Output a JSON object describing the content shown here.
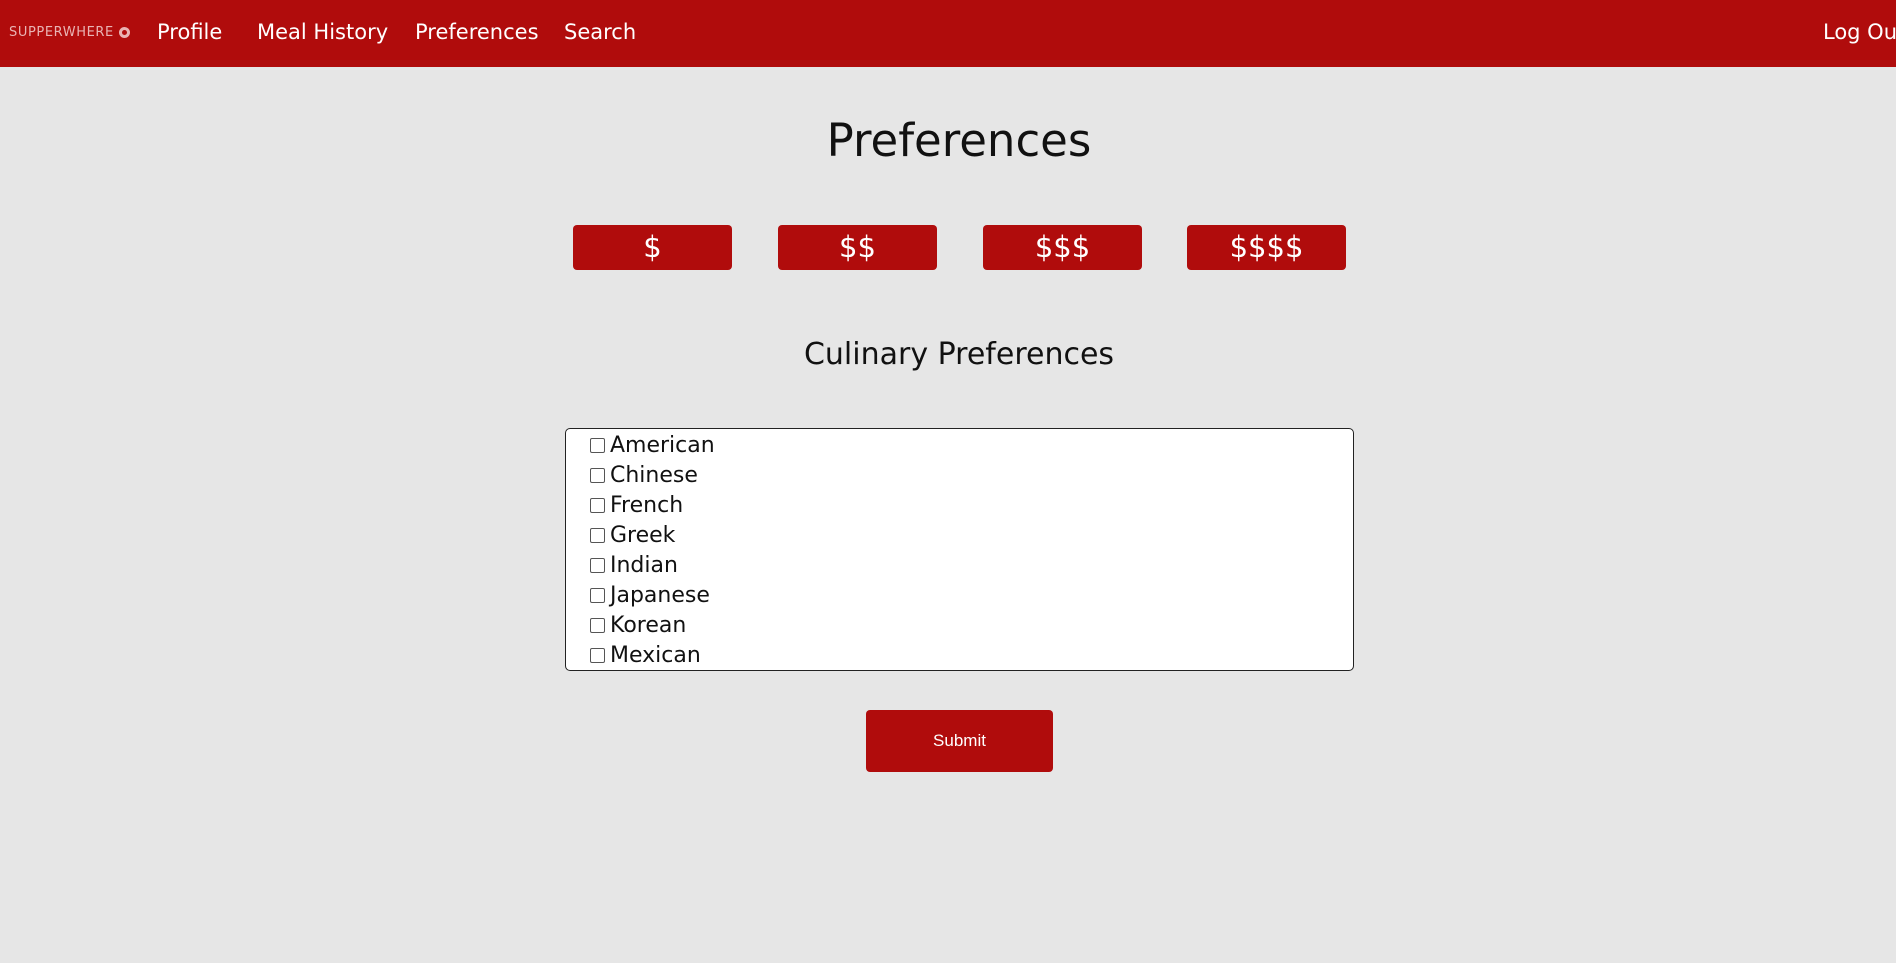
{
  "nav": {
    "brand": "SUPPERWHERE",
    "links": {
      "profile": "Profile",
      "meal_history": "Meal History",
      "preferences": "Preferences",
      "search": "Search",
      "logout": "Log Out"
    }
  },
  "main": {
    "title": "Preferences",
    "price_options": [
      "$",
      "$$",
      "$$$",
      "$$$$"
    ],
    "culinary_title": "Culinary Preferences",
    "cuisines": [
      {
        "label": "American",
        "checked": false
      },
      {
        "label": "Chinese",
        "checked": false
      },
      {
        "label": "French",
        "checked": false
      },
      {
        "label": "Greek",
        "checked": false
      },
      {
        "label": "Indian",
        "checked": false
      },
      {
        "label": "Japanese",
        "checked": false
      },
      {
        "label": "Korean",
        "checked": false
      },
      {
        "label": "Mexican",
        "checked": false
      }
    ],
    "submit_label": "Submit"
  },
  "colors": {
    "brand_red": "#b00c0c",
    "page_background": "#e6e6e6"
  }
}
